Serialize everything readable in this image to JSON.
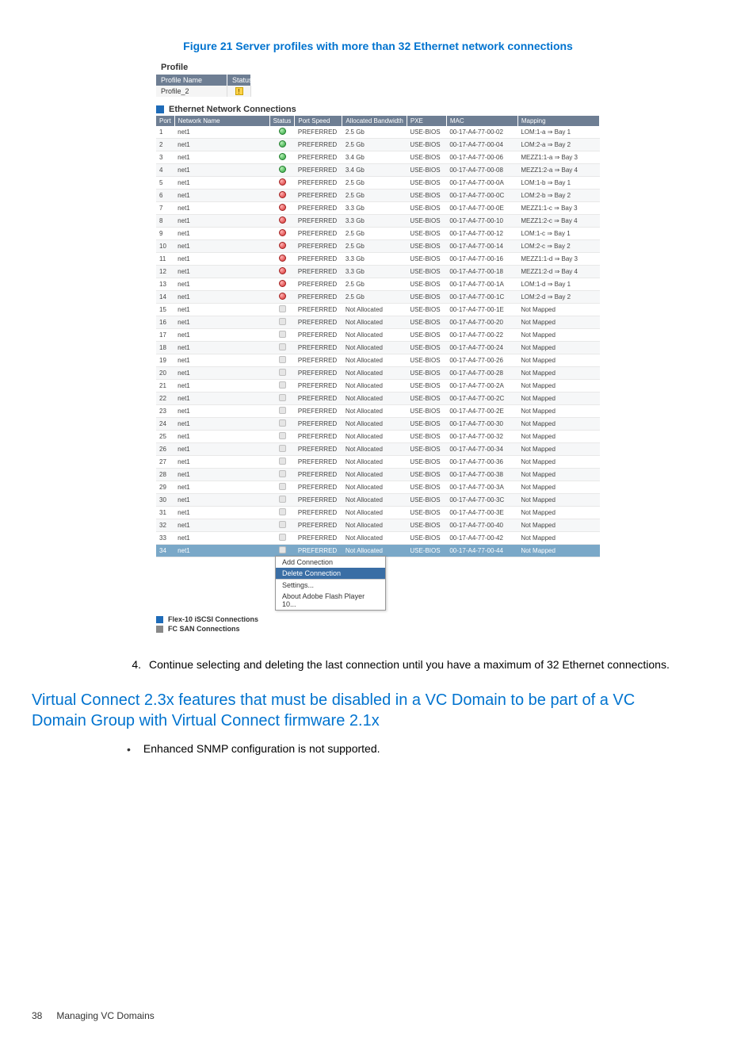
{
  "figure": {
    "caption": "Figure 21 Server profiles with more than 32 Ethernet network connections"
  },
  "profile": {
    "title": "Profile",
    "header_name_label": "Profile Name",
    "header_status_label": "Status",
    "name_value": "Profile_2"
  },
  "table": {
    "section_title": "Ethernet Network Connections",
    "columns": {
      "port": "Port",
      "network": "Network Name",
      "status": "Status",
      "speed": "Port Speed",
      "bw": "Allocated Bandwidth",
      "pxe": "PXE",
      "mac": "MAC",
      "mapping": "Mapping"
    },
    "rows": [
      {
        "port": "1",
        "net": "net1",
        "st": "ok",
        "speed": "PREFERRED",
        "bw": "2.5 Gb",
        "pxe": "USE-BIOS",
        "mac": "00-17-A4-77-00-02",
        "map": "LOM:1-a ⇒ Bay 1"
      },
      {
        "port": "2",
        "net": "net1",
        "st": "ok",
        "speed": "PREFERRED",
        "bw": "2.5 Gb",
        "pxe": "USE-BIOS",
        "mac": "00-17-A4-77-00-04",
        "map": "LOM:2-a ⇒ Bay 2"
      },
      {
        "port": "3",
        "net": "net1",
        "st": "ok",
        "speed": "PREFERRED",
        "bw": "3.4 Gb",
        "pxe": "USE-BIOS",
        "mac": "00-17-A4-77-00-06",
        "map": "MEZZ1:1-a ⇒ Bay 3"
      },
      {
        "port": "4",
        "net": "net1",
        "st": "ok",
        "speed": "PREFERRED",
        "bw": "3.4 Gb",
        "pxe": "USE-BIOS",
        "mac": "00-17-A4-77-00-08",
        "map": "MEZZ1:2-a ⇒ Bay 4"
      },
      {
        "port": "5",
        "net": "net1",
        "st": "err",
        "speed": "PREFERRED",
        "bw": "2.5 Gb",
        "pxe": "USE-BIOS",
        "mac": "00-17-A4-77-00-0A",
        "map": "LOM:1-b ⇒ Bay 1"
      },
      {
        "port": "6",
        "net": "net1",
        "st": "err",
        "speed": "PREFERRED",
        "bw": "2.5 Gb",
        "pxe": "USE-BIOS",
        "mac": "00-17-A4-77-00-0C",
        "map": "LOM:2-b ⇒ Bay 2"
      },
      {
        "port": "7",
        "net": "net1",
        "st": "err",
        "speed": "PREFERRED",
        "bw": "3.3 Gb",
        "pxe": "USE-BIOS",
        "mac": "00-17-A4-77-00-0E",
        "map": "MEZZ1:1-c ⇒ Bay 3"
      },
      {
        "port": "8",
        "net": "net1",
        "st": "err",
        "speed": "PREFERRED",
        "bw": "3.3 Gb",
        "pxe": "USE-BIOS",
        "mac": "00-17-A4-77-00-10",
        "map": "MEZZ1:2-c ⇒ Bay 4"
      },
      {
        "port": "9",
        "net": "net1",
        "st": "err",
        "speed": "PREFERRED",
        "bw": "2.5 Gb",
        "pxe": "USE-BIOS",
        "mac": "00-17-A4-77-00-12",
        "map": "LOM:1-c ⇒ Bay 1"
      },
      {
        "port": "10",
        "net": "net1",
        "st": "err",
        "speed": "PREFERRED",
        "bw": "2.5 Gb",
        "pxe": "USE-BIOS",
        "mac": "00-17-A4-77-00-14",
        "map": "LOM:2-c ⇒ Bay 2"
      },
      {
        "port": "11",
        "net": "net1",
        "st": "err",
        "speed": "PREFERRED",
        "bw": "3.3 Gb",
        "pxe": "USE-BIOS",
        "mac": "00-17-A4-77-00-16",
        "map": "MEZZ1:1-d ⇒ Bay 3"
      },
      {
        "port": "12",
        "net": "net1",
        "st": "err",
        "speed": "PREFERRED",
        "bw": "3.3 Gb",
        "pxe": "USE-BIOS",
        "mac": "00-17-A4-77-00-18",
        "map": "MEZZ1:2-d ⇒ Bay 4"
      },
      {
        "port": "13",
        "net": "net1",
        "st": "err",
        "speed": "PREFERRED",
        "bw": "2.5 Gb",
        "pxe": "USE-BIOS",
        "mac": "00-17-A4-77-00-1A",
        "map": "LOM:1-d ⇒ Bay 1"
      },
      {
        "port": "14",
        "net": "net1",
        "st": "err",
        "speed": "PREFERRED",
        "bw": "2.5 Gb",
        "pxe": "USE-BIOS",
        "mac": "00-17-A4-77-00-1C",
        "map": "LOM:2-d ⇒ Bay 2"
      },
      {
        "port": "15",
        "net": "net1",
        "st": "none",
        "speed": "PREFERRED",
        "bw": "Not Allocated",
        "pxe": "USE-BIOS",
        "mac": "00-17-A4-77-00-1E",
        "map": "Not Mapped"
      },
      {
        "port": "16",
        "net": "net1",
        "st": "none",
        "speed": "PREFERRED",
        "bw": "Not Allocated",
        "pxe": "USE-BIOS",
        "mac": "00-17-A4-77-00-20",
        "map": "Not Mapped"
      },
      {
        "port": "17",
        "net": "net1",
        "st": "none",
        "speed": "PREFERRED",
        "bw": "Not Allocated",
        "pxe": "USE-BIOS",
        "mac": "00-17-A4-77-00-22",
        "map": "Not Mapped"
      },
      {
        "port": "18",
        "net": "net1",
        "st": "none",
        "speed": "PREFERRED",
        "bw": "Not Allocated",
        "pxe": "USE-BIOS",
        "mac": "00-17-A4-77-00-24",
        "map": "Not Mapped"
      },
      {
        "port": "19",
        "net": "net1",
        "st": "none",
        "speed": "PREFERRED",
        "bw": "Not Allocated",
        "pxe": "USE-BIOS",
        "mac": "00-17-A4-77-00-26",
        "map": "Not Mapped"
      },
      {
        "port": "20",
        "net": "net1",
        "st": "none",
        "speed": "PREFERRED",
        "bw": "Not Allocated",
        "pxe": "USE-BIOS",
        "mac": "00-17-A4-77-00-28",
        "map": "Not Mapped"
      },
      {
        "port": "21",
        "net": "net1",
        "st": "none",
        "speed": "PREFERRED",
        "bw": "Not Allocated",
        "pxe": "USE-BIOS",
        "mac": "00-17-A4-77-00-2A",
        "map": "Not Mapped"
      },
      {
        "port": "22",
        "net": "net1",
        "st": "none",
        "speed": "PREFERRED",
        "bw": "Not Allocated",
        "pxe": "USE-BIOS",
        "mac": "00-17-A4-77-00-2C",
        "map": "Not Mapped"
      },
      {
        "port": "23",
        "net": "net1",
        "st": "none",
        "speed": "PREFERRED",
        "bw": "Not Allocated",
        "pxe": "USE-BIOS",
        "mac": "00-17-A4-77-00-2E",
        "map": "Not Mapped"
      },
      {
        "port": "24",
        "net": "net1",
        "st": "none",
        "speed": "PREFERRED",
        "bw": "Not Allocated",
        "pxe": "USE-BIOS",
        "mac": "00-17-A4-77-00-30",
        "map": "Not Mapped"
      },
      {
        "port": "25",
        "net": "net1",
        "st": "none",
        "speed": "PREFERRED",
        "bw": "Not Allocated",
        "pxe": "USE-BIOS",
        "mac": "00-17-A4-77-00-32",
        "map": "Not Mapped"
      },
      {
        "port": "26",
        "net": "net1",
        "st": "none",
        "speed": "PREFERRED",
        "bw": "Not Allocated",
        "pxe": "USE-BIOS",
        "mac": "00-17-A4-77-00-34",
        "map": "Not Mapped"
      },
      {
        "port": "27",
        "net": "net1",
        "st": "none",
        "speed": "PREFERRED",
        "bw": "Not Allocated",
        "pxe": "USE-BIOS",
        "mac": "00-17-A4-77-00-36",
        "map": "Not Mapped"
      },
      {
        "port": "28",
        "net": "net1",
        "st": "none",
        "speed": "PREFERRED",
        "bw": "Not Allocated",
        "pxe": "USE-BIOS",
        "mac": "00-17-A4-77-00-38",
        "map": "Not Mapped"
      },
      {
        "port": "29",
        "net": "net1",
        "st": "none",
        "speed": "PREFERRED",
        "bw": "Not Allocated",
        "pxe": "USE-BIOS",
        "mac": "00-17-A4-77-00-3A",
        "map": "Not Mapped"
      },
      {
        "port": "30",
        "net": "net1",
        "st": "none",
        "speed": "PREFERRED",
        "bw": "Not Allocated",
        "pxe": "USE-BIOS",
        "mac": "00-17-A4-77-00-3C",
        "map": "Not Mapped"
      },
      {
        "port": "31",
        "net": "net1",
        "st": "none",
        "speed": "PREFERRED",
        "bw": "Not Allocated",
        "pxe": "USE-BIOS",
        "mac": "00-17-A4-77-00-3E",
        "map": "Not Mapped"
      },
      {
        "port": "32",
        "net": "net1",
        "st": "none",
        "speed": "PREFERRED",
        "bw": "Not Allocated",
        "pxe": "USE-BIOS",
        "mac": "00-17-A4-77-00-40",
        "map": "Not Mapped"
      },
      {
        "port": "33",
        "net": "net1",
        "st": "none",
        "speed": "PREFERRED",
        "bw": "Not Allocated",
        "pxe": "USE-BIOS",
        "mac": "00-17-A4-77-00-42",
        "map": "Not Mapped"
      },
      {
        "port": "34",
        "net": "net1",
        "st": "none",
        "speed": "PREFERRED",
        "bw": "Not Allocated",
        "pxe": "USE-BIOS",
        "mac": "00-17-A4-77-00-44",
        "map": "Not Mapped",
        "sel": true
      }
    ]
  },
  "context_menu": {
    "add": "Add Connection",
    "delete": "Delete Connection",
    "settings": "Settings...",
    "about": "About Adobe Flash Player 10..."
  },
  "sub": {
    "iscsi": "Flex-10 iSCSI Connections",
    "fc": "FC SAN Connections"
  },
  "step4": {
    "num": "4.",
    "text": "Continue selecting and deleting the last connection until you have a maximum of 32 Ethernet connections."
  },
  "heading2": "Virtual Connect 2.3x features that must be disabled in a VC Domain to be part of a VC Domain Group with Virtual Connect firmware 2.1x",
  "bullet1": "Enhanced SNMP configuration is not supported.",
  "footer": {
    "page": "38",
    "chapter": "Managing VC Domains"
  }
}
